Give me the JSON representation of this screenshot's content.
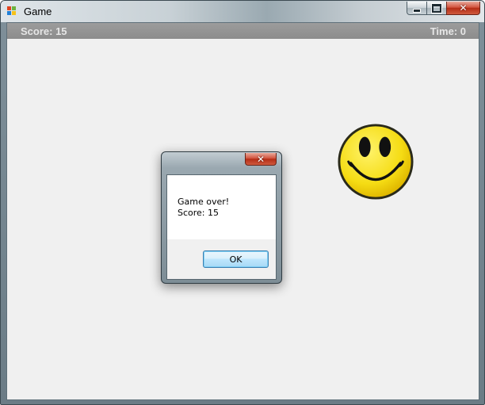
{
  "window": {
    "title": "Game",
    "app_icon": "windows-app-icon",
    "controls": [
      "minimize-icon",
      "maximize-icon",
      "close-icon"
    ]
  },
  "hud": {
    "score_text": "Score: 15",
    "time_text": "Time: 0"
  },
  "game": {
    "sprite": "smiley-face-icon",
    "sprite_color": "#f5dc14"
  },
  "dialog": {
    "message_line1": "Game over!",
    "message_line2": "Score: 15",
    "ok_label": "OK",
    "close_icon": "close-icon"
  },
  "colors": {
    "hud_bar": "#8f8f8f",
    "client_bg": "#f0f0f0",
    "close_button": "#c8402a"
  }
}
